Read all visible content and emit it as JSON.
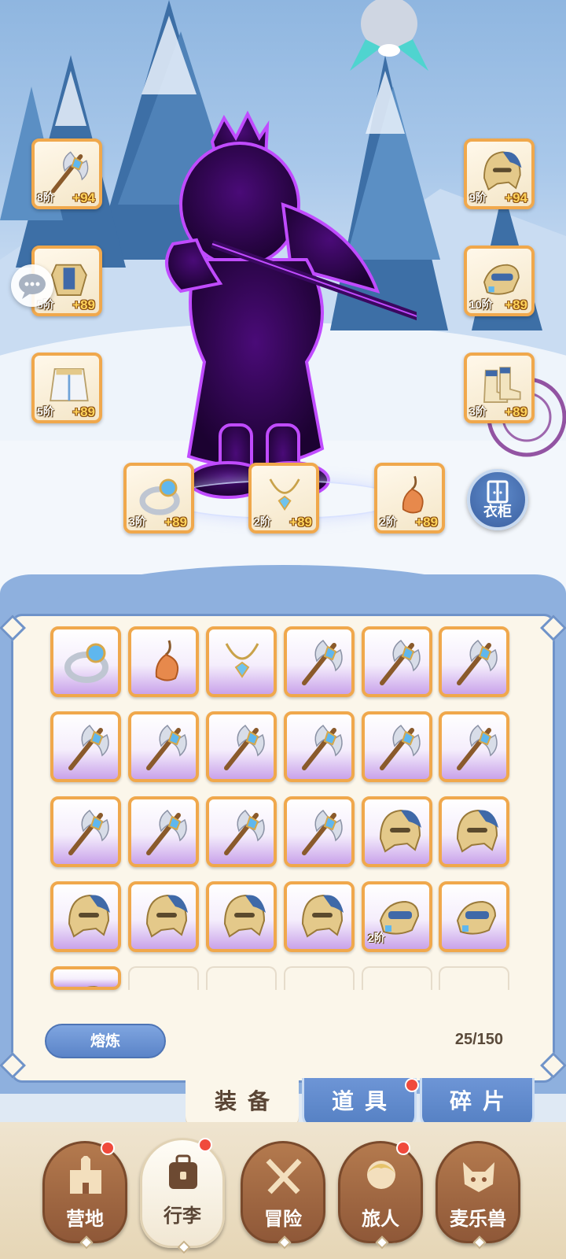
{
  "equipped": {
    "left": [
      {
        "icon": "axe-staff-icon",
        "tier": "8阶",
        "plus": "+94"
      },
      {
        "icon": "armor-icon",
        "tier": "5阶",
        "plus": "+89"
      },
      {
        "icon": "skirt-armor-icon",
        "tier": "5阶",
        "plus": "+89"
      }
    ],
    "right": [
      {
        "icon": "helmet-icon",
        "tier": "9阶",
        "plus": "+94"
      },
      {
        "icon": "gauntlet-icon",
        "tier": "10阶",
        "plus": "+89"
      },
      {
        "icon": "boots-icon",
        "tier": "3阶",
        "plus": "+89"
      }
    ],
    "bottom": [
      {
        "icon": "ring-icon",
        "tier": "3阶",
        "plus": "+89"
      },
      {
        "icon": "necklace-icon",
        "tier": "2阶",
        "plus": "+89"
      },
      {
        "icon": "charm-icon",
        "tier": "2阶",
        "plus": "+89"
      }
    ]
  },
  "wardrobe": {
    "label": "衣柜",
    "icon": "wardrobe-icon"
  },
  "chat": {
    "icon": "chat-bubble-icon"
  },
  "inventory": {
    "items": [
      {
        "icon": "ring-icon"
      },
      {
        "icon": "charm-icon"
      },
      {
        "icon": "necklace-icon"
      },
      {
        "icon": "axe-staff-icon"
      },
      {
        "icon": "axe-staff-icon"
      },
      {
        "icon": "axe-staff-icon"
      },
      {
        "icon": "axe-staff-icon"
      },
      {
        "icon": "axe-staff-icon"
      },
      {
        "icon": "axe-staff-icon"
      },
      {
        "icon": "axe-staff-icon"
      },
      {
        "icon": "axe-staff-icon"
      },
      {
        "icon": "axe-staff-icon"
      },
      {
        "icon": "axe-staff-icon"
      },
      {
        "icon": "axe-staff-icon"
      },
      {
        "icon": "axe-staff-icon"
      },
      {
        "icon": "axe-staff-icon"
      },
      {
        "icon": "helmet-icon"
      },
      {
        "icon": "helmet-icon"
      },
      {
        "icon": "helmet-icon"
      },
      {
        "icon": "helmet-icon"
      },
      {
        "icon": "helmet-icon"
      },
      {
        "icon": "helmet-icon"
      },
      {
        "icon": "gauntlet-icon",
        "tier": "2阶"
      },
      {
        "icon": "gauntlet-icon"
      },
      {
        "icon": "gauntlet-icon"
      }
    ],
    "smelt_label": "熔炼",
    "capacity": "25/150"
  },
  "tabs": [
    {
      "label": "装备",
      "active": true,
      "badge": false
    },
    {
      "label": "道具",
      "active": false,
      "badge": true
    },
    {
      "label": "碎片",
      "active": false,
      "badge": false
    }
  ],
  "nav": [
    {
      "label": "营地",
      "icon": "castle-icon",
      "badge": true,
      "active": false
    },
    {
      "label": "行李",
      "icon": "backpack-icon",
      "badge": true,
      "active": true
    },
    {
      "label": "冒险",
      "icon": "crossed-swords-icon",
      "badge": false,
      "active": false
    },
    {
      "label": "旅人",
      "icon": "traveler-icon",
      "badge": true,
      "active": false
    },
    {
      "label": "麦乐兽",
      "icon": "cat-pet-icon",
      "badge": false,
      "active": false
    }
  ],
  "colors": {
    "slot_border": "#f0a84c",
    "panel_blue": "#8eb0de",
    "badge_red": "#f04a3c",
    "shadow_purple": "#7a1fc0"
  }
}
